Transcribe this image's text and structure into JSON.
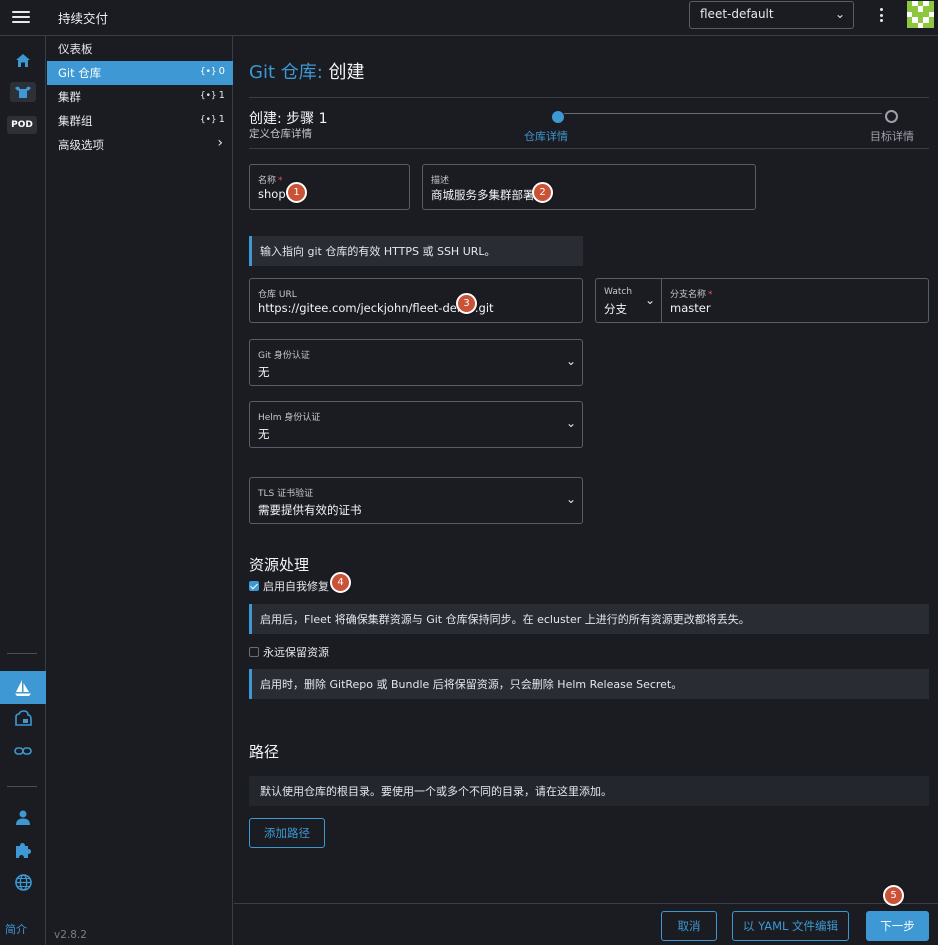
{
  "topbar": {
    "title": "持续交付",
    "namespace": "fleet-default"
  },
  "rail": {
    "pod_label": "POD",
    "about": "简介"
  },
  "nav": {
    "items": [
      {
        "label": "仪表板"
      },
      {
        "label": "Git 仓库",
        "count": "0"
      },
      {
        "label": "集群",
        "count": "1"
      },
      {
        "label": "集群组",
        "count": "1"
      },
      {
        "label": "高级选项"
      }
    ],
    "version": "v2.8.2"
  },
  "page": {
    "title_link": "Git 仓库:",
    "title_action": "创建",
    "step_title": "创建: 步骤 1",
    "step_subtitle": "定义仓库详情",
    "steps": [
      "仓库详情",
      "目标详情"
    ]
  },
  "form": {
    "name": {
      "label": "名称",
      "value": "shop"
    },
    "description": {
      "label": "描述",
      "value": "商城服务多集群部署"
    },
    "repo_hint": "输入指向 git 仓库的有效 HTTPS 或 SSH URL。",
    "repo_url": {
      "label": "仓库 URL",
      "value": "https://gitee.com/jeckjohn/fleet-demo.git"
    },
    "watch": {
      "label": "Watch",
      "value": "分支"
    },
    "branch": {
      "label": "分支名称",
      "value": "master"
    },
    "git_auth": {
      "label": "Git 身份认证",
      "value": "无"
    },
    "helm_auth": {
      "label": "Helm 身份认证",
      "value": "无"
    },
    "tls": {
      "label": "TLS 证书验证",
      "value": "需要提供有效的证书"
    }
  },
  "resources": {
    "title": "资源处理",
    "self_heal_label": "启用自我修复",
    "self_heal_checked": true,
    "self_heal_info": "启用后，Fleet 将确保集群资源与 Git 仓库保持同步。在 ecluster 上进行的所有资源更改都将丢失。",
    "keep_label": "永远保留资源",
    "keep_checked": false,
    "keep_info": "启用时，删除 GitRepo 或 Bundle 后将保留资源，只会删除 Helm Release Secret。"
  },
  "paths": {
    "title": "路径",
    "info": "默认使用仓库的根目录。要使用一个或多个不同的目录，请在这里添加。",
    "add_button": "添加路径"
  },
  "footer": {
    "cancel": "取消",
    "yaml": "以 YAML 文件编辑",
    "next": "下一步"
  },
  "markers": [
    "1",
    "2",
    "3",
    "4",
    "5"
  ],
  "colors": {
    "accent": "#3d98d3",
    "background": "#1b1c21",
    "marker": "#c95237"
  }
}
